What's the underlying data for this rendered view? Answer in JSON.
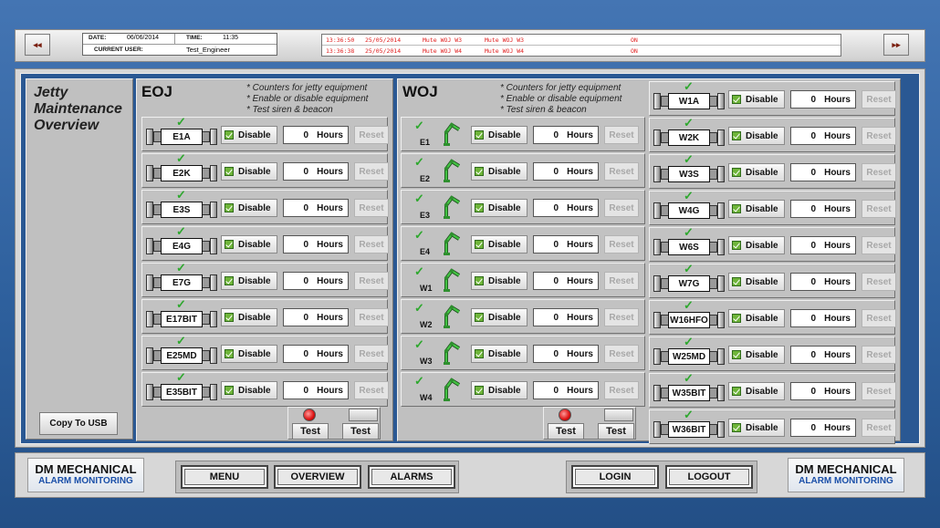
{
  "header": {
    "date_label": "DATE:",
    "date_value": "06/06/2014",
    "time_label": "TIME:",
    "time_value": "11:35",
    "user_label": "CURRENT USER:",
    "user_value": "Test_Engineer",
    "prev_icon": "◂◂",
    "next_icon": "▸▸",
    "alarms": [
      {
        "time": "13:36:50",
        "date": "25/05/2014",
        "desc1": "Mute WOJ W3",
        "desc2": "Mute WOJ W3",
        "state": "ON"
      },
      {
        "time": "13:36:38",
        "date": "25/05/2014",
        "desc1": "Mute WOJ W4",
        "desc2": "Mute WOJ W4",
        "state": "ON"
      }
    ],
    "alarm_color": "#e02020"
  },
  "side": {
    "title_line1": "Jetty",
    "title_line2": "Maintenance",
    "title_line3": "Overview",
    "copy_label": "Copy To USB"
  },
  "eoj": {
    "title": "EOJ",
    "notes": [
      "* Counters for jetty equipment",
      "* Enable or disable equipment",
      "* Test siren & beacon"
    ],
    "rows": [
      {
        "name": "E1A",
        "disable": "Disable",
        "hours": "0",
        "unit": "Hours",
        "reset": "Reset"
      },
      {
        "name": "E2K",
        "disable": "Disable",
        "hours": "0",
        "unit": "Hours",
        "reset": "Reset"
      },
      {
        "name": "E3S",
        "disable": "Disable",
        "hours": "0",
        "unit": "Hours",
        "reset": "Reset"
      },
      {
        "name": "E4G",
        "disable": "Disable",
        "hours": "0",
        "unit": "Hours",
        "reset": "Reset"
      },
      {
        "name": "E7G",
        "disable": "Disable",
        "hours": "0",
        "unit": "Hours",
        "reset": "Reset"
      },
      {
        "name": "E17BIT",
        "disable": "Disable",
        "hours": "0",
        "unit": "Hours",
        "reset": "Reset"
      },
      {
        "name": "E25MD",
        "disable": "Disable",
        "hours": "0",
        "unit": "Hours",
        "reset": "Reset"
      },
      {
        "name": "E35BIT",
        "disable": "Disable",
        "hours": "0",
        "unit": "Hours",
        "reset": "Reset"
      }
    ],
    "test1": "Test",
    "test2": "Test"
  },
  "woj": {
    "title": "WOJ",
    "notes": [
      "* Counters for jetty equipment",
      "* Enable or disable equipment",
      "* Test siren & beacon"
    ],
    "arms": [
      {
        "name": "E1",
        "disable": "Disable",
        "hours": "0",
        "unit": "Hours",
        "reset": "Reset"
      },
      {
        "name": "E2",
        "disable": "Disable",
        "hours": "0",
        "unit": "Hours",
        "reset": "Reset"
      },
      {
        "name": "E3",
        "disable": "Disable",
        "hours": "0",
        "unit": "Hours",
        "reset": "Reset"
      },
      {
        "name": "E4",
        "disable": "Disable",
        "hours": "0",
        "unit": "Hours",
        "reset": "Reset"
      },
      {
        "name": "W1",
        "disable": "Disable",
        "hours": "0",
        "unit": "Hours",
        "reset": "Reset"
      },
      {
        "name": "W2",
        "disable": "Disable",
        "hours": "0",
        "unit": "Hours",
        "reset": "Reset"
      },
      {
        "name": "W3",
        "disable": "Disable",
        "hours": "0",
        "unit": "Hours",
        "reset": "Reset"
      },
      {
        "name": "W4",
        "disable": "Disable",
        "hours": "0",
        "unit": "Hours",
        "reset": "Reset"
      }
    ],
    "rows": [
      {
        "name": "W1A",
        "disable": "Disable",
        "hours": "0",
        "unit": "Hours",
        "reset": "Reset"
      },
      {
        "name": "W2K",
        "disable": "Disable",
        "hours": "0",
        "unit": "Hours",
        "reset": "Reset"
      },
      {
        "name": "W3S",
        "disable": "Disable",
        "hours": "0",
        "unit": "Hours",
        "reset": "Reset"
      },
      {
        "name": "W4G",
        "disable": "Disable",
        "hours": "0",
        "unit": "Hours",
        "reset": "Reset"
      },
      {
        "name": "W6S",
        "disable": "Disable",
        "hours": "0",
        "unit": "Hours",
        "reset": "Reset"
      },
      {
        "name": "W7G",
        "disable": "Disable",
        "hours": "0",
        "unit": "Hours",
        "reset": "Reset"
      },
      {
        "name": "W16HFO",
        "disable": "Disable",
        "hours": "0",
        "unit": "Hours",
        "reset": "Reset"
      },
      {
        "name": "W25MD",
        "disable": "Disable",
        "hours": "0",
        "unit": "Hours",
        "reset": "Reset"
      },
      {
        "name": "W35BIT",
        "disable": "Disable",
        "hours": "0",
        "unit": "Hours",
        "reset": "Reset"
      },
      {
        "name": "W36BIT",
        "disable": "Disable",
        "hours": "0",
        "unit": "Hours",
        "reset": "Reset"
      }
    ],
    "test1": "Test",
    "test2": "Test"
  },
  "footer": {
    "brand_line1": "DM MECHANICAL",
    "brand_line2": "ALARM MONITORING",
    "menu": "MENU",
    "overview": "OVERVIEW",
    "alarms": "ALARMS",
    "login": "LOGIN",
    "logout": "LOGOUT"
  },
  "colors": {
    "tick": "#2ea82e",
    "brand_blue": "#1a4fa8"
  },
  "icons": {
    "ok": "✓",
    "siren": "siren-icon",
    "beacon": "beacon-icon"
  }
}
